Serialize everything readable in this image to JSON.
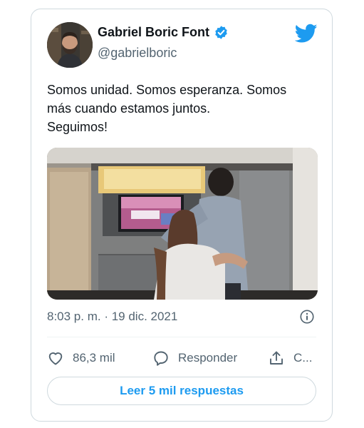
{
  "user": {
    "display_name": "Gabriel Boric Font",
    "handle": "@gabrielboric",
    "verified": true
  },
  "tweet": {
    "text_lines": [
      "Somos unidad. Somos esperanza. Somos",
      "más cuando estamos juntos.",
      "Seguimos!"
    ],
    "timestamp": "8:03 p. m. · 19 dic. 2021"
  },
  "actions": {
    "like_count": "86,3 mil",
    "reply_label": "Responder",
    "share_label": "C..."
  },
  "read_replies_label": "Leer 5 mil respuestas",
  "icons": {
    "brand": "twitter-bird-icon",
    "verified": "verified-badge-icon",
    "info": "info-icon",
    "like": "heart-icon",
    "reply": "comment-bubble-icon",
    "share": "share-upload-icon"
  },
  "colors": {
    "accent": "#1d9bf0",
    "text_primary": "#0f1419",
    "text_secondary": "#536471",
    "border": "#cfd9de"
  }
}
